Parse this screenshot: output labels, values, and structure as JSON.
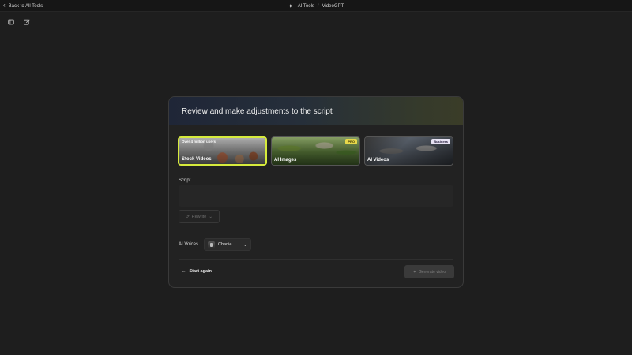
{
  "topbar": {
    "back_label": "Back to All Tools",
    "breadcrumb_1": "AI Tools",
    "breadcrumb_sep": "/",
    "breadcrumb_2": "VideoGPT"
  },
  "panel": {
    "title": "Review and make adjustments to the script",
    "options": [
      {
        "label": "Stock Videos",
        "tagline": "Over 4 million users",
        "selected": true
      },
      {
        "label": "AI Images",
        "badge": "PRO"
      },
      {
        "label": "AI Videos",
        "badge": "Business"
      }
    ],
    "script_label": "Script",
    "script_value": "",
    "rewrite_label": "Rewrite",
    "voices_label": "AI Voices",
    "voice_selected": "Charlie",
    "start_again_label": "Start again",
    "generate_label": "Generate video"
  },
  "colors": {
    "selected_border": "#d6ea3c",
    "pro_badge": "#e8d84a",
    "business_badge": "#e7e2f3"
  }
}
